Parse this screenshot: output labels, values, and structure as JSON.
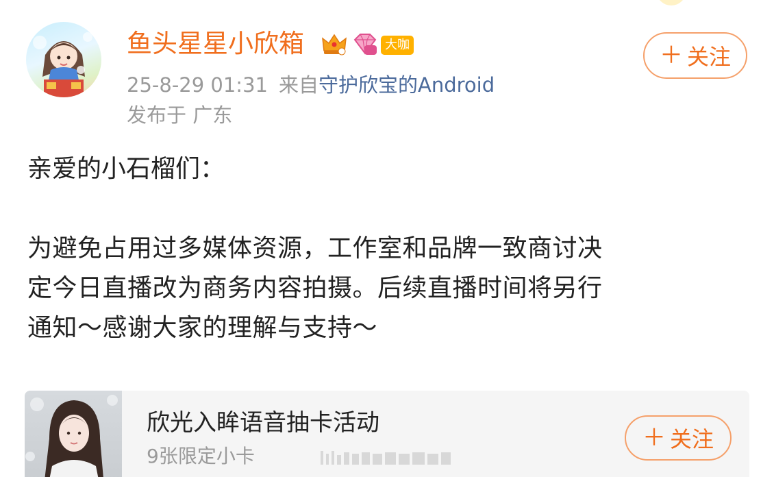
{
  "post": {
    "author_name": "鱼头星星小欣箱",
    "vip_badge": "大咖",
    "timestamp": "25-8-29 01:31",
    "source_prefix": "来自",
    "source_name": "守护欣宝的Android",
    "location": "发布于 广东",
    "follow_label": "关注",
    "body": {
      "greeting": "亲爱的小石榴们：",
      "line1": "为避免占用过多媒体资源，工作室和品牌一致商讨决",
      "line2": "定今日直播改为商务内容拍摄。后续直播时间将另行",
      "line3": "通知～感谢大家的理解与支持～"
    }
  },
  "card": {
    "title": "欣光入眸语音抽卡活动",
    "subtitle": "9张限定小卡",
    "follow_label": "关注"
  },
  "icons": {
    "crown": "crown-icon",
    "gem": "gem-icon",
    "plus": "plus-icon"
  },
  "colors": {
    "accent_orange": "#f06e1d",
    "link_blue": "#4b6a9b",
    "muted_gray": "#9a9a9a",
    "badge_gold": "#ffb100"
  }
}
